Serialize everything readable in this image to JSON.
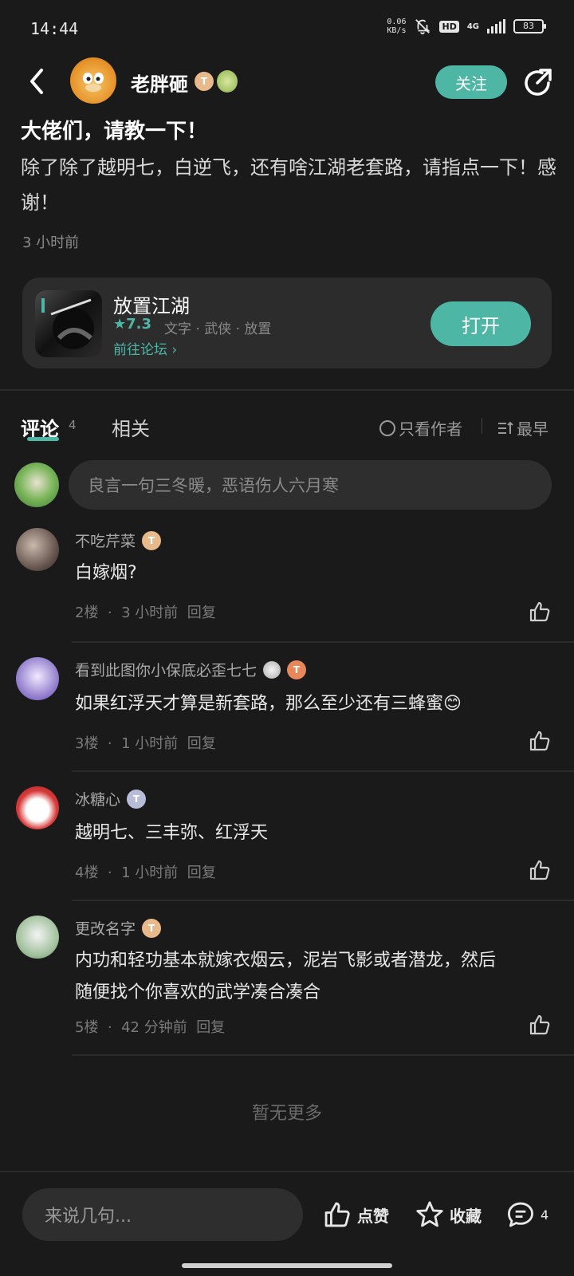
{
  "status_bar": {
    "time": "14:44",
    "net_speed_top": "0.06",
    "net_speed_bottom": "KB/s",
    "hd": "HD",
    "network": "4G",
    "battery": "83"
  },
  "header": {
    "author_name": "老胖砸",
    "follow_label": "关注",
    "level_badge": "T"
  },
  "post": {
    "title": "大佬们，请教一下！",
    "body": "除了除了越明七，白逆飞，还有啥江湖老套路，请指点一下！感谢！",
    "time": "3 小时前"
  },
  "game_card": {
    "name": "放置江湖",
    "rating": "★7.3",
    "tags": "文字 · 武侠 · 放置",
    "forum_link": "前往论坛 ›",
    "open_label": "打开"
  },
  "tabs": {
    "comments_label": "评论",
    "comments_count": "4",
    "related_label": "相关",
    "only_author": "只看作者",
    "sort_label": "最早"
  },
  "comment_input": {
    "placeholder": "良言一句三冬暖，恶语伤人六月寒"
  },
  "comments": [
    {
      "name": "不吃芹菜",
      "badge": "T",
      "text": "白嫁烟?",
      "floor": "2楼",
      "sep": "·",
      "time": "3 小时前",
      "reply": "回复"
    },
    {
      "name": "看到此图你小保底必歪七七",
      "badge": "T",
      "text": "如果红浮天才算是新套路，那么至少还有三蜂蜜😊",
      "floor": "3楼",
      "sep": "·",
      "time": "1 小时前",
      "reply": "回复"
    },
    {
      "name": "冰糖心",
      "badge": "T",
      "text": "越明七、三丰弥、红浮天",
      "floor": "4楼",
      "sep": "·",
      "time": "1 小时前",
      "reply": "回复"
    },
    {
      "name": "更改名字",
      "badge": "T",
      "text_line1": "内功和轻功基本就嫁衣烟云，泥岩飞影或者潜龙，然后",
      "text_line2": "随便找个你喜欢的武学凑合凑合",
      "floor": "5楼",
      "sep": "·",
      "time": "42 分钟前",
      "reply": "回复"
    }
  ],
  "no_more": "暂无更多",
  "bottom_bar": {
    "input_placeholder": "来说几句...",
    "like_label": "点赞",
    "favorite_label": "收藏",
    "comment_count": "4"
  },
  "colors": {
    "accent": "#4db6a5",
    "background": "#1a1a1a",
    "card": "#2c2c2c"
  }
}
